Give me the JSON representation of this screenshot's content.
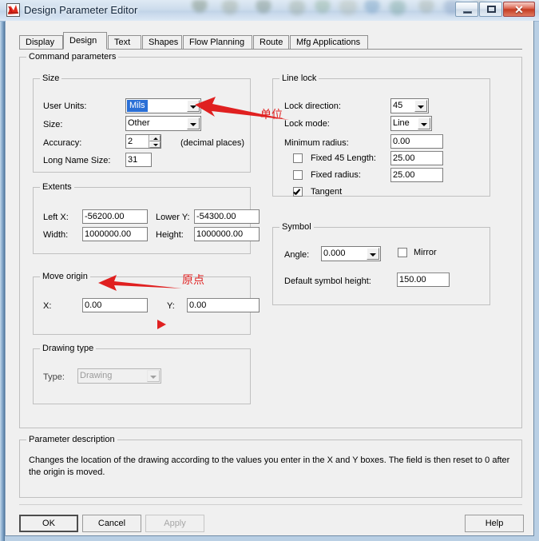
{
  "window": {
    "title": "Design Parameter Editor",
    "icon": "app-icon",
    "controls": {
      "minimize": "minimize-icon",
      "maximize": "maximize-icon",
      "close": "close-icon"
    }
  },
  "tabs": [
    {
      "label": "Display",
      "active": false
    },
    {
      "label": "Design",
      "active": true
    },
    {
      "label": "Text",
      "active": false
    },
    {
      "label": "Shapes",
      "active": false
    },
    {
      "label": "Flow Planning",
      "active": false
    },
    {
      "label": "Route",
      "active": false
    },
    {
      "label": "Mfg Applications",
      "active": false
    }
  ],
  "command_parameters": {
    "title": "Command parameters",
    "size": {
      "title": "Size",
      "user_units_label": "User Units:",
      "user_units_value": "Mils",
      "size_label": "Size:",
      "size_value": "Other",
      "accuracy_label": "Accuracy:",
      "accuracy_value": "2",
      "accuracy_suffix": "(decimal places)",
      "long_name_size_label": "Long Name Size:",
      "long_name_size_value": "31"
    },
    "extents": {
      "title": "Extents",
      "left_x_label": "Left X:",
      "left_x_value": "-56200.00",
      "lower_y_label": "Lower Y:",
      "lower_y_value": "-54300.00",
      "width_label": "Width:",
      "width_value": "1000000.00",
      "height_label": "Height:",
      "height_value": "1000000.00"
    },
    "move_origin": {
      "title": "Move origin",
      "x_label": "X:",
      "x_value": "0.00",
      "y_label": "Y:",
      "y_value": "0.00"
    },
    "drawing_type": {
      "title": "Drawing type",
      "type_label": "Type:",
      "type_value": "Drawing"
    },
    "line_lock": {
      "title": "Line lock",
      "lock_direction_label": "Lock direction:",
      "lock_direction_value": "45",
      "lock_mode_label": "Lock mode:",
      "lock_mode_value": "Line",
      "minimum_radius_label": "Minimum radius:",
      "minimum_radius_value": "0.00",
      "fixed_45_length_label": "Fixed 45 Length:",
      "fixed_45_length_value": "25.00",
      "fixed_45_length_checked": false,
      "fixed_radius_label": "Fixed radius:",
      "fixed_radius_value": "25.00",
      "fixed_radius_checked": false,
      "tangent_label": "Tangent",
      "tangent_checked": true
    },
    "symbol": {
      "title": "Symbol",
      "angle_label": "Angle:",
      "angle_value": "0.000",
      "mirror_label": "Mirror",
      "mirror_checked": false,
      "default_symbol_height_label": "Default symbol height:",
      "default_symbol_height_value": "150.00"
    }
  },
  "parameter_description": {
    "title": "Parameter description",
    "text": "Changes the location of the drawing according to the values you enter in the X and Y boxes. The field is then reset to 0 after the origin is moved."
  },
  "buttons": {
    "ok": "OK",
    "cancel": "Cancel",
    "apply": "Apply",
    "help": "Help"
  },
  "annotations": [
    {
      "text": "单位",
      "meaning": "unit"
    },
    {
      "text": "原点",
      "meaning": "origin"
    }
  ],
  "colors": {
    "annotation": "#e02020",
    "selection": "#2a6fd6",
    "dialog_bg": "#f0f0f0"
  }
}
